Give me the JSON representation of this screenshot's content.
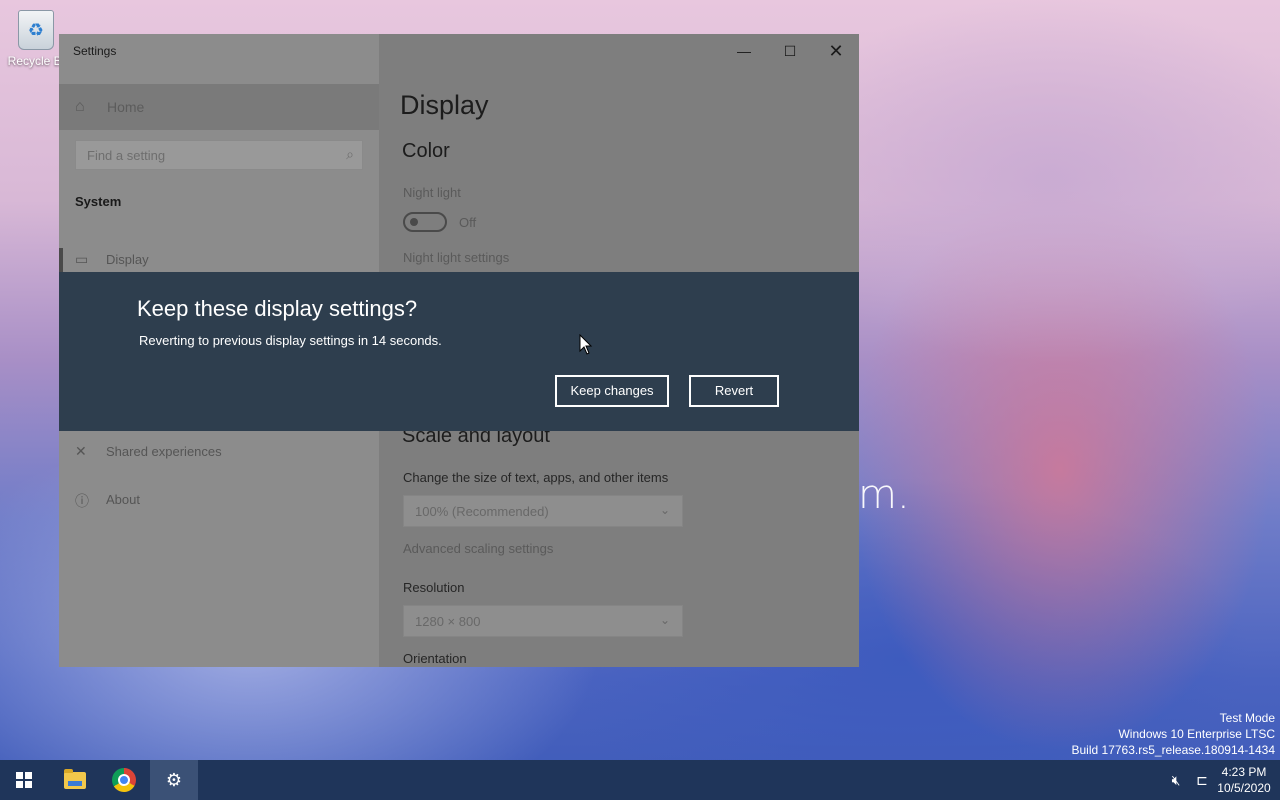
{
  "desktop": {
    "recycle_bin_label": "Recycle Bi",
    "background_text": "m."
  },
  "window": {
    "title": "Settings",
    "controls": {
      "minimize": "—",
      "maximize": "☐",
      "close": "✕"
    }
  },
  "sidebar": {
    "home_label": "Home",
    "search_placeholder": "Find a setting",
    "section_label": "System",
    "items": [
      {
        "label": "Display",
        "icon": "monitor-icon"
      },
      {
        "label": "Shared experiences",
        "icon": "shared-experiences-icon"
      },
      {
        "label": "About",
        "icon": "info-icon"
      }
    ]
  },
  "main": {
    "page_title": "Display",
    "color_heading": "Color",
    "night_light_label": "Night light",
    "night_light_state": "Off",
    "night_light_settings_link": "Night light settings",
    "scale_heading": "Scale and layout",
    "scale_label": "Change the size of text, apps, and other items",
    "scale_value": "100% (Recommended)",
    "advanced_scaling_link": "Advanced scaling settings",
    "resolution_label": "Resolution",
    "resolution_value": "1280 × 800",
    "orientation_label": "Orientation"
  },
  "dialog": {
    "title": "Keep these display settings?",
    "message": "Reverting to previous display settings in 14 seconds.",
    "keep_label": "Keep changes",
    "revert_label": "Revert"
  },
  "watermark": {
    "line1": "Test Mode",
    "line2": "Windows 10 Enterprise LTSC",
    "line3": "Build 17763.rs5_release.180914-1434"
  },
  "taskbar": {
    "clock_time": "4:23 PM",
    "clock_date": "10/5/2020"
  },
  "colors": {
    "dialog_bg": "#2e3e4e",
    "taskbar_bg": "#1f355a"
  }
}
